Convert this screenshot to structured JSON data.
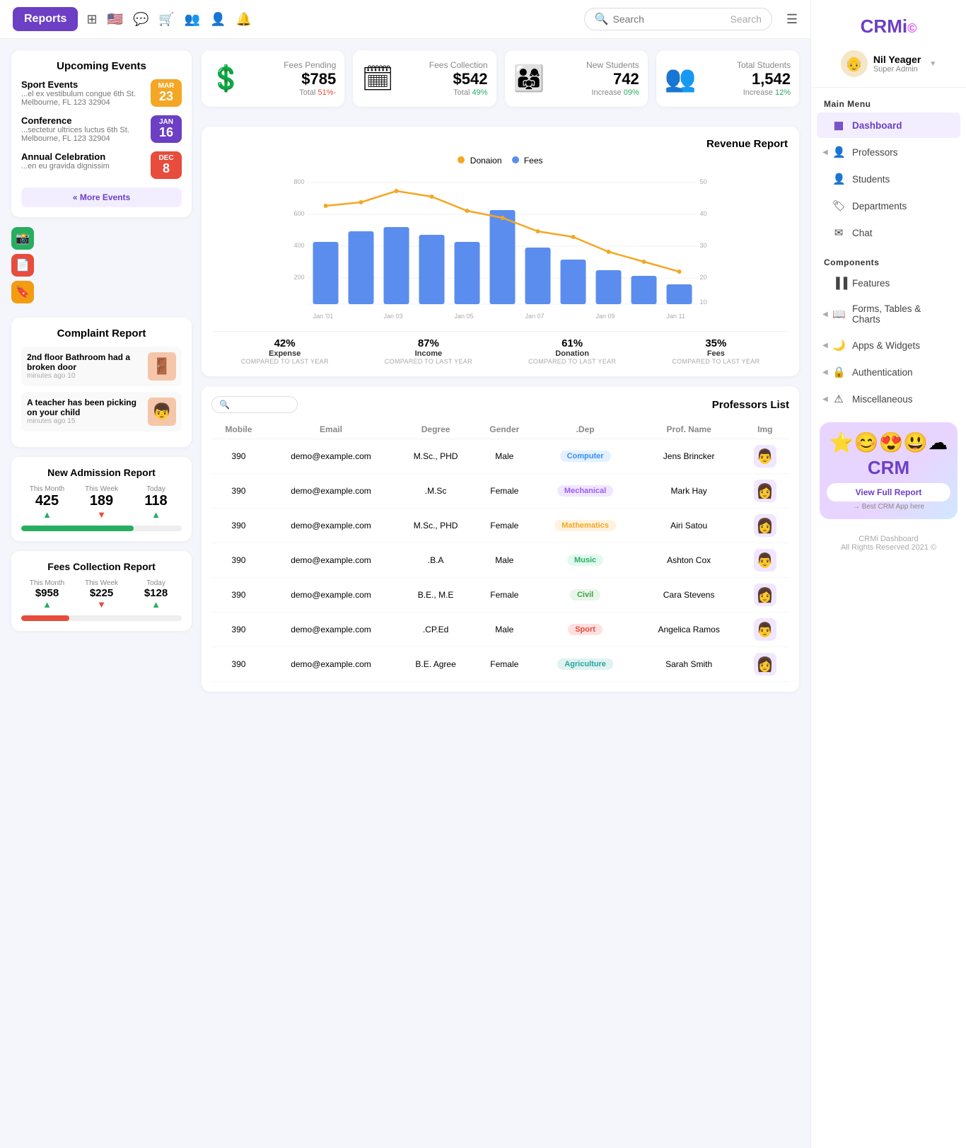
{
  "header": {
    "logo": "Reports",
    "search_placeholder": "Search",
    "icons": [
      "grid",
      "flag",
      "chat",
      "cart",
      "user-group",
      "group",
      "bell"
    ]
  },
  "sidebar": {
    "logo_text": "CRMi",
    "logo_icon": "©",
    "user": {
      "name": "Nil Yeager",
      "role": "Super Admin"
    },
    "main_menu_label": "Main Menu",
    "items": [
      {
        "label": "Dashboard",
        "icon": "▦",
        "active": true,
        "has_arrow": false
      },
      {
        "label": "Professors",
        "icon": "👤",
        "active": false,
        "has_arrow": true
      },
      {
        "label": "Students",
        "icon": "👤",
        "active": false,
        "has_arrow": false
      },
      {
        "label": "Departments",
        "icon": "🏷",
        "active": false,
        "has_arrow": false
      },
      {
        "label": "Chat",
        "icon": "✉",
        "active": false,
        "has_arrow": false
      }
    ],
    "components_label": "Components",
    "components_items": [
      {
        "label": "Features",
        "icon": "▐▐",
        "has_arrow": false
      },
      {
        "label": "Forms, Tables & Charts",
        "icon": "📖",
        "has_arrow": true
      },
      {
        "label": "Apps & Widgets",
        "icon": "🌙",
        "has_arrow": true
      },
      {
        "label": "Authentication",
        "icon": "🔒",
        "has_arrow": true
      },
      {
        "label": "Miscellaneous",
        "icon": "⚠",
        "has_arrow": true
      }
    ],
    "crm_banner": {
      "title": "View Full Report",
      "subtitle": "→ Best CRM App here",
      "emojis": "⭐😊😍😃☁"
    },
    "footer": {
      "title": "CRMi Dashboard",
      "copy": "All Rights Reserved 2021 ©"
    }
  },
  "top_stats": [
    {
      "icon": "💲",
      "title": "Fees Pending",
      "value": "$785",
      "sub_label": "Total",
      "sub_val": "51%",
      "trend": "down"
    },
    {
      "icon": "📅",
      "title": "Fees Collection",
      "value": "$542",
      "sub_label": "Total",
      "sub_val": "49%",
      "trend": "up"
    },
    {
      "icon": "👨‍👩‍👧‍👦",
      "title": "New Students",
      "value": "742",
      "sub_label": "Increase",
      "sub_val": "09%",
      "trend": "up"
    },
    {
      "icon": "👥",
      "title": "Total Students",
      "value": "1,542",
      "sub_label": "Increase",
      "sub_val": "12%",
      "trend": "up"
    }
  ],
  "upcoming_events": {
    "title": "Upcoming Events",
    "events": [
      {
        "name": "Sport Events",
        "desc": "...el ex vestibulum congue 6th St. Melbourne, FL 123 32904",
        "month": "MAR",
        "day": "23",
        "badge_class": "badge-mar"
      },
      {
        "name": "Conference",
        "desc": "...sectetur ultrices luctus 6th St. Melbourne, FL 123 32904",
        "month": "JAN",
        "day": "16",
        "badge_class": "badge-jan"
      },
      {
        "name": "Annual Celebration",
        "desc": "...en eu gravida dignissim",
        "month": "DEC",
        "day": "8",
        "badge_class": "badge-dec"
      }
    ],
    "more_btn": "« More Events"
  },
  "complaint_report": {
    "title": "Complaint Report",
    "items": [
      {
        "text": "2nd floor Bathroom had a broken door",
        "time": "minutes ago 10",
        "icon": "🚪"
      },
      {
        "text": "A teacher has been picking on your child",
        "time": "minutes ago 15",
        "icon": "👦"
      }
    ]
  },
  "admission_report": {
    "title": "New Admission Report",
    "this_month_label": "This Month",
    "this_week_label": "This Week",
    "today_label": "Today",
    "this_month_val": "425",
    "this_week_val": "189",
    "today_val": "118",
    "this_month_trend": "up",
    "this_week_trend": "down",
    "today_trend": "up",
    "progress": 70
  },
  "fees_collection_report": {
    "title": "Fees Collection Report",
    "this_month_label": "This Month",
    "this_week_label": "This Week",
    "today_label": "Today",
    "this_month_val": "$958",
    "this_week_val": "$225",
    "today_val": "$128",
    "this_month_trend": "up",
    "this_week_trend": "down",
    "today_trend": "up",
    "progress": 30
  },
  "revenue_report": {
    "title": "Revenue Report",
    "legend": [
      {
        "label": "Donaion",
        "color_class": "legend-orange"
      },
      {
        "label": "Fees",
        "color_class": "legend-blue"
      }
    ],
    "x_labels": [
      "Jan '01",
      "Jan 03",
      "Jan 05",
      "Jan 07",
      "Jan 09",
      "Jan 11"
    ],
    "bars": [
      380,
      430,
      460,
      410,
      380,
      590,
      340,
      250,
      200,
      170,
      110
    ],
    "line": [
      40,
      42,
      48,
      44,
      38,
      35,
      30,
      28,
      22,
      18,
      14
    ],
    "stats": [
      {
        "pct": "42%",
        "label": "Expense",
        "sub": "Compared to last year"
      },
      {
        "pct": "87%",
        "label": "Income",
        "sub": "Compared to last year"
      },
      {
        "pct": "61%",
        "label": "Donation",
        "sub": "Compared to last year"
      },
      {
        "pct": "35%",
        "label": "Fees",
        "sub": "Compared to last year"
      }
    ]
  },
  "professors_list": {
    "title": "Professors List",
    "search_placeholder": "",
    "columns": [
      "Mobile",
      "Email",
      "Degree",
      "Gender",
      ".Dep",
      "Prof. Name",
      "Img"
    ],
    "rows": [
      {
        "mobile": "390",
        "email": "demo@example.com",
        "degree": "M.Sc., PHD",
        "gender": "Male",
        "dept": "Computer",
        "dept_class": "dept-computer",
        "name": "Jens Brincker",
        "avatar": "👨"
      },
      {
        "mobile": "390",
        "email": "demo@example.com",
        "degree": ".M.Sc",
        "gender": "Female",
        "dept": "Mechanical",
        "dept_class": "dept-mechanical",
        "name": "Mark Hay",
        "avatar": "👩"
      },
      {
        "mobile": "390",
        "email": "demo@example.com",
        "degree": "M.Sc., PHD",
        "gender": "Female",
        "dept": "Mathematics",
        "dept_class": "dept-mathematics",
        "name": "Airi Satou",
        "avatar": "👩"
      },
      {
        "mobile": "390",
        "email": "demo@example.com",
        "degree": ".B.A",
        "gender": "Male",
        "dept": "Music",
        "dept_class": "dept-music",
        "name": "Ashton Cox",
        "avatar": "👨"
      },
      {
        "mobile": "390",
        "email": "demo@example.com",
        "degree": "B.E., M.E",
        "gender": "Female",
        "dept": "Civil",
        "dept_class": "dept-civil",
        "name": "Cara Stevens",
        "avatar": "👩"
      },
      {
        "mobile": "390",
        "email": "demo@example.com",
        "degree": ".CP.Ed",
        "gender": "Male",
        "dept": "Sport",
        "dept_class": "dept-sport",
        "name": "Angelica Ramos",
        "avatar": "👨"
      },
      {
        "mobile": "390",
        "email": "demo@example.com",
        "degree": "B.E. Agree",
        "gender": "Female",
        "dept": "Agriculture",
        "dept_class": "dept-agriculture",
        "name": "Sarah Smith",
        "avatar": "👩"
      }
    ]
  }
}
